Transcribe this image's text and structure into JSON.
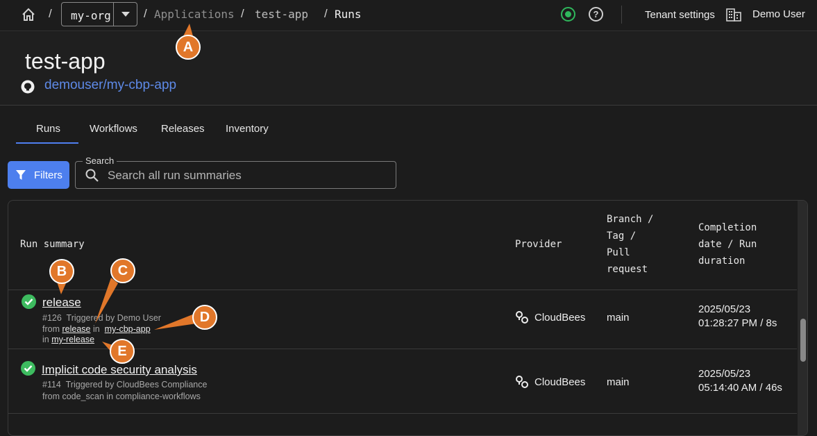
{
  "topbar": {
    "org": "my-org",
    "breadcrumbs": [
      "Applications",
      "test-app",
      "Runs"
    ],
    "tenant_settings": "Tenant settings",
    "user": "Demo User"
  },
  "app": {
    "title": "test-app",
    "repo": "demouser/my-cbp-app"
  },
  "tabs": [
    "Runs",
    "Workflows",
    "Releases",
    "Inventory"
  ],
  "filters_label": "Filters",
  "search": {
    "label": "Search",
    "placeholder": "Search all run summaries"
  },
  "table": {
    "headers": {
      "summary": "Run summary",
      "provider": "Provider",
      "branch": [
        "Branch /",
        "Tag /",
        "Pull",
        "request"
      ],
      "completion": [
        "Completion",
        "date / Run",
        "duration"
      ]
    },
    "rows": [
      {
        "title": "release",
        "number": "#126",
        "triggered": "Triggered by Demo User",
        "from_prefix": "from",
        "from": "release",
        "in_prefix": "in",
        "repo": "my-cbp-app",
        "in_prefix2": "in",
        "env": "my-release",
        "provider": "CloudBees",
        "branch": "main",
        "date": "2025/05/23",
        "time": "01:28:27 PM / 8s"
      },
      {
        "title": "Implicit code security analysis",
        "number": "#114",
        "triggered": "Triggered by CloudBees Compliance",
        "from_line": "from code_scan in compliance-workflows",
        "provider": "CloudBees",
        "branch": "main",
        "date": "2025/05/23",
        "time": "05:14:40 AM / 46s"
      }
    ]
  },
  "callouts": [
    "A",
    "B",
    "C",
    "D",
    "E"
  ],
  "colors": {
    "accent": "#4d7fee",
    "link": "#5e8ae8",
    "success": "#3dbb5f",
    "callout": "#e1772a"
  }
}
